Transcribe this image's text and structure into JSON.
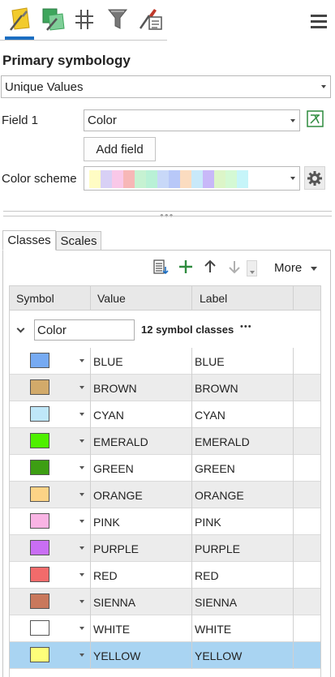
{
  "toolbar": {
    "tabs": [
      {
        "name": "primary-symbology-tab-icon",
        "active": true
      },
      {
        "name": "vary-symbology-tab-icon"
      },
      {
        "name": "symbol-layers-tab-icon"
      },
      {
        "name": "filter-tab-icon"
      },
      {
        "name": "symbol-properties-tab-icon"
      }
    ],
    "menu_icon": "hamburger-menu-icon"
  },
  "section_title": "Primary symbology",
  "renderer": {
    "value": "Unique Values"
  },
  "field1": {
    "label": "Field 1",
    "value": "Color"
  },
  "add_field_label": "Add field",
  "color_scheme": {
    "label": "Color scheme",
    "colors": [
      "#fffcc4",
      "#d8d0f5",
      "#f9c8e8",
      "#f7b7b7",
      "#c6f2d2",
      "#b9f1d6",
      "#c8d8f8",
      "#b8c8f8",
      "#fbdcc0",
      "#c8e9f9",
      "#c8b8f8",
      "#dcf5c8",
      "#d4f9d4",
      "#c6f5f9"
    ]
  },
  "tabs": {
    "classes": "Classes",
    "scales": "Scales"
  },
  "classes_toolbar": {
    "more_label": "More"
  },
  "grid": {
    "headers": {
      "symbol": "Symbol",
      "value": "Value",
      "label": "Label"
    },
    "group": {
      "field": "Color",
      "count_text": "12 symbol classes",
      "more": "•••"
    },
    "rows": [
      {
        "value": "BLUE",
        "label": "BLUE",
        "color": "#76aaf2"
      },
      {
        "value": "BROWN",
        "label": "BROWN",
        "color": "#d2aa6a"
      },
      {
        "value": "CYAN",
        "label": "CYAN",
        "color": "#bfe7f9"
      },
      {
        "value": "EMERALD",
        "label": "EMERALD",
        "color": "#4ef000"
      },
      {
        "value": "GREEN",
        "label": "GREEN",
        "color": "#3d9e13"
      },
      {
        "value": "ORANGE",
        "label": "ORANGE",
        "color": "#fcd386"
      },
      {
        "value": "PINK",
        "label": "PINK",
        "color": "#f9b4e4"
      },
      {
        "value": "PURPLE",
        "label": "PURPLE",
        "color": "#c96ef4"
      },
      {
        "value": "RED",
        "label": "RED",
        "color": "#f26b6b"
      },
      {
        "value": "SIENNA",
        "label": "SIENNA",
        "color": "#c9785c"
      },
      {
        "value": "WHITE",
        "label": "WHITE",
        "color": "#ffffff"
      },
      {
        "value": "YELLOW",
        "label": "YELLOW",
        "color": "#fefe7a",
        "selected": true
      }
    ]
  }
}
